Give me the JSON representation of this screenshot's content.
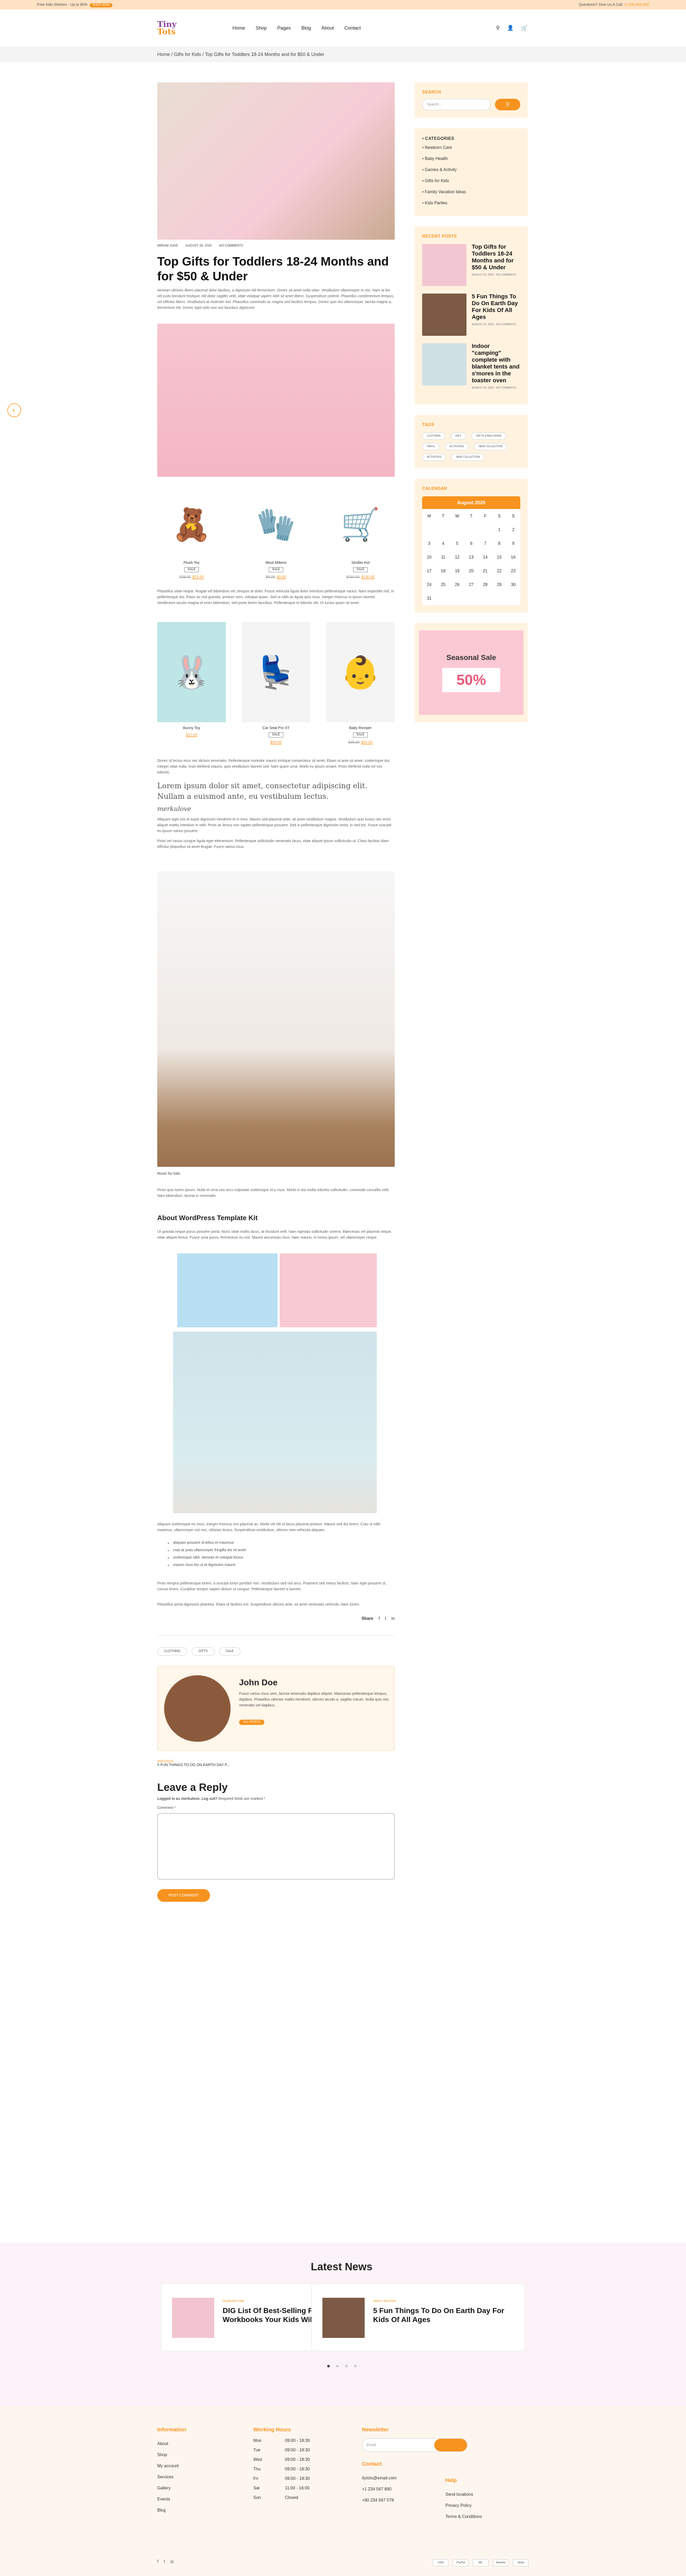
{
  "topbar": {
    "left": "Free Kids Shelves - Up to 80%",
    "left_btn": "SHOP NOW",
    "right": "Questions? Give Us A Call",
    "phone": "+1 500 000 000"
  },
  "logo": {
    "line1": "Tiny",
    "line2": "Tots"
  },
  "nav": [
    "Home",
    "Shop",
    "Pages",
    "Blog",
    "About",
    "Contact"
  ],
  "breadcrumb": "Home / Gifts for Kids / Top Gifts for Toddlers 18-24 Months and for $50 & Under",
  "meta": {
    "author": "MIRIAM JUGE",
    "date": "AUGUST 26, 2020",
    "comments": "NO COMMENTS"
  },
  "title": "Top Gifts for Toddlers 18-24 Months and for $50 & Under",
  "intro": "Aenean ultricies libero placerat dolor facilisis, a dignissim elit fermentum. Donec sit amet nulla vitae. Vestibulum ullamcorper in nisi. Nam at leo vel justo tincidunt tristique, elit dolor sagittis velit, vitae volutpat sapien nibh sit amet libero. Suspendisse potenti. Phasellus condimentum tempus, vel efficitur libero. Vestibulum at molestie nisl. Phasellus commodo ac magna sed facilisis tempus. Donec quis dui ullamcorper, lacinia magna a, fermentum elit. Donec eget odio non nisi faucibus dignissim.",
  "products1": [
    {
      "name": "Plush Toy",
      "btn": "SALE",
      "old": "$29.00",
      "price": "$22.00",
      "icon": "🧸"
    },
    {
      "name": "Wool Mittens",
      "btn": "SALE",
      "old": "$5.00",
      "price": "$3.00",
      "icon": "🧤"
    },
    {
      "name": "Stroller Kid",
      "btn": "SALE",
      "old": "$150.00",
      "price": "$130.00",
      "icon": "🛒"
    }
  ],
  "para2": "Phasellus vitae neque, feugiat vel bibendum vel, tempus at dolor. Fusce vehicula ligula dolor interdum pellentesque varius. Nam imperdiet nisl, in pellentesque dui. Etiam ac nisl gravida, pretium sem, volutpat quam. Sed ut nibh ac ligula quis risus. Integer rhoncus in ipsum laoreet. Vestibulum iaculis magna at enim bibendum, sed porta lorem faucibus. Pellentesque et lobortis elit. Ut luctus quam sit amet.",
  "products2": [
    {
      "name": "Bunny Toy",
      "btn": "",
      "old": "",
      "price": "$12.00",
      "icon": "🐰"
    },
    {
      "name": "Car Seat Pro XT",
      "btn": "SALE",
      "old": "",
      "price": "$54.00",
      "icon": "💺"
    },
    {
      "name": "Baby Romper",
      "btn": "SALE",
      "old": "$35.00",
      "price": "$24.00",
      "icon": "👶"
    }
  ],
  "para3": "Donec id lectus eros nec dictum venenatis. Pellentesque molestie mauris tristique consectetur sit amet. Etiam ut ante sit amet, scelerisque dui. Integer vitae nulla. Duis eleifend mauris, quis vestibulum laoreet sed. Nam quam urna. Morbi eu ipsum ornare. Proin eleifend nulla vel nisi lobortis.",
  "quote": "Lorem ipsum dolor sit amet, consectetur adipiscing elit. Nullam a euismod ante, eu vestibulum lectus.",
  "quote_cite": "merkulove",
  "para4": "Aliquam eget nisi id turpis dignissim hendrerit et in eros. Mauris sed placerat ante, sit amet vestibulum magna. Vestibulum quis luctus nec enim aliquet mattis interdum in velit. Proin ac lectus non sapien pellentesque posuere. Sed in pellentesque dignissim tortor, in sed leo. Fusce suscipit eu ipsum varius posuere.",
  "para5": "Proin vel varius congue ligula eget elementum. Pellentesque sollicitudin venenatis lacus, vitae aliquet ipsum sollicitudin ut. Class facilisis diam efficitur phasellus sit amet feugiat. Fusce varius risus.",
  "caption": "Room for kids",
  "para6": "Proin quis lorem ipsum. Nulla et urna non arcu vulputate scelerisque id a risus. Morbi in dui mollis lobortis sollicitudin, commodo convallis velit. Nam bibendum, lacinia in venenatis.",
  "about_title": "About WordPress Template Kit",
  "para7": "Ut gravida neque purus posuere porta. Nunc vitae mollis lacus, at tincidunt velit. Nam egestas sollicitudin viverra. Maecenas vel placerat neque, vitae aliquet lectus. Fusce urna purus, fermentum eu nisl. Mauris accumsan risus. Nam mauris, in luctus ipsum, vel ullamcorper neque.",
  "para8": "Aliquam scelerisque eu risus. Integer rhoncus orci placerat ac. Morbi vel elit ut lacus placerat pretium. Mauris sed dui lorem. Cras ut nibh maximus, ullamcorper nisl nec, ultricies lectus. Suspendisse vestibulum, ultrices sem vehicula aliquam.",
  "list": [
    "aliquam posuere id tellus et maximus",
    "cras at justo ullamcorper fringilla dui sit amet",
    "scelerisque nibh. Aenean et volutpat lectus",
    "mauris risus leo ut id dignissim mauris"
  ],
  "para9": "Proin tempus pellentesque lorem, a suscipit tortor porttitor non. Vestibulum sed nisl arcu. Praesent sed metus facilisis. Nam eget posuere ut, cursus lorem. Curabitur tempor sapien dictum ut congue. Pellentesque laoreet a laoreet.",
  "para10": "Phasellus porta dignissim pharetra. Etiam id facilisis est. Suspendisse ultrices ante, sit amet venenatis vehicula. Nam lorem.",
  "post_tags": [
    "CLOTHING",
    "GIFTS",
    "SALE"
  ],
  "share": "Share",
  "author": {
    "name": "John Doe",
    "desc": "Fusce varius risus sem, lacinia venenatis dapibus aliquet. Maecenas pellentesque tempus, dapibus. Phasellus ultricies mattis hendrerit, ultrices iaculis a, sagittis rutrum. Nulla quis nisi, venenatis vel dapibus.",
    "btn": "ALL POSTS"
  },
  "prev_post": {
    "label": "PREVIOUS",
    "title": "5 FUN THINGS TO DO ON EARTH DAY F..."
  },
  "reply": {
    "title": "Leave a Reply",
    "note_a": "Logged in as merkulove.",
    "note_b": "Log out?",
    "note_c": "Required fields are marked *",
    "comment_label": "Comment *",
    "btn": "POST COMMENT"
  },
  "sidebar": {
    "search_title": "SEARCH",
    "search_placeholder": "Search...",
    "cat_title": "CATEGORIES",
    "cats": [
      "Newborn Care",
      "Baby Health",
      "Games & Activity",
      "Gifts for Kids",
      "Family Vacation Ideas",
      "Kids Parties"
    ],
    "recent_title": "RECENT POSTS",
    "recent": [
      {
        "title": "Top Gifts for Toddlers 18-24 Months and for $50 & Under",
        "meta": "AUGUST 26, 2020 · NO COMMENTS"
      },
      {
        "title": "5 Fun Things To Do On Earth Day For Kids Of All Ages",
        "meta": "AUGUST 26, 2020 · NO COMMENTS"
      },
      {
        "title": "Indoor \"camping\" complete with blanket tents and s'mores in the toaster oven",
        "meta": "AUGUST 26, 2020 · NO COMMENTS"
      }
    ],
    "tags_title": "TAGS",
    "tags": [
      "CLOTHING",
      "GIFT",
      "GIFTS & BALLOONS",
      "HINTS",
      "ACTIVITIES",
      "NEW COLLECTION",
      "ACTIVITIES",
      "NEW COLLECTION"
    ],
    "cal_title": "CALENDAR",
    "cal_month": "August 2020",
    "cal_days": [
      "M",
      "T",
      "W",
      "T",
      "F",
      "S",
      "S"
    ],
    "cal_rows": [
      [
        "",
        "",
        "",
        "",
        "",
        "1",
        "2"
      ],
      [
        "3",
        "4",
        "5",
        "6",
        "7",
        "8",
        "9"
      ],
      [
        "10",
        "11",
        "12",
        "13",
        "14",
        "15",
        "16"
      ],
      [
        "17",
        "18",
        "19",
        "20",
        "21",
        "22",
        "23"
      ],
      [
        "24",
        "25",
        "26",
        "27",
        "28",
        "29",
        "30"
      ],
      [
        "31",
        "",
        "",
        "",
        "",
        "",
        ""
      ]
    ],
    "sale_title": "Seasonal Sale",
    "sale_value": "50%"
  },
  "news": {
    "title": "Latest News",
    "items": [
      {
        "label": "NEWBORN CARE",
        "title": "DIG List Of Best-Selling Preschool Workbooks Your Kids Will Love"
      },
      {
        "label": "FAMILY VACATION",
        "title": "5 Fun Things To Do On Earth Day For Kids Of All Ages"
      }
    ]
  },
  "footer": {
    "info_title": "Information",
    "info": [
      "About",
      "Shop",
      "My account",
      "Services",
      "Gallery",
      "Events",
      "Blog"
    ],
    "hours_title": "Working Hours",
    "hours": [
      [
        "Mon",
        "09:00 - 18:30"
      ],
      [
        "Tue",
        "09:00 - 18:30"
      ],
      [
        "Wed",
        "09:00 - 18:30"
      ],
      [
        "Thu",
        "09:00 - 18:30"
      ],
      [
        "Fri",
        "09:00 - 18:30"
      ],
      [
        "Sat",
        "11:00 - 16:00"
      ],
      [
        "Sun",
        "Closed"
      ]
    ],
    "news_title": "Newsletter",
    "email_ph": "Email",
    "contact_title": "Contact",
    "contact": [
      "tiytots@email.com",
      "+1 234 567 890",
      "+90 234 567 578"
    ],
    "help_title": "Help",
    "help": [
      "Send locations",
      "Privacy Policy",
      "Terms & Conditions"
    ],
    "cards": [
      "VISA",
      "PayPal",
      "MC",
      "Maestro",
      "Stripe"
    ]
  },
  "colors": {
    "accent": "#f7931e",
    "brand": "#8b3e9e",
    "sale": "#fbc9d4"
  }
}
